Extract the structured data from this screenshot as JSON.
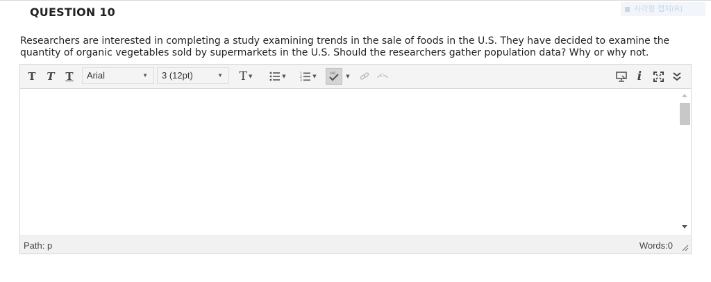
{
  "question": {
    "title": "QUESTION 10",
    "text": "Researchers are interested in completing a study examining trends in the sale of foods in the U.S. They have decided to examine the quantity of organic vegetables sold by supermarkets in the U.S. Should the researchers gather population data?  Why or why not."
  },
  "capture_badge": {
    "label": "사각형 캡처(R)"
  },
  "toolbar": {
    "bold_label": "T",
    "italic_label": "T",
    "underline_label": "T",
    "font_family": "Arial",
    "font_size": "3 (12pt)",
    "text_color_label": "T",
    "icons": [
      "format-text-icon",
      "unordered-list-icon",
      "ordered-list-icon",
      "spellcheck-icon",
      "link-icon",
      "unlink-icon",
      "preview-icon",
      "info-icon",
      "fullscreen-icon",
      "collapse-icon"
    ]
  },
  "editor": {
    "path_label": "Path: p",
    "word_count": "Words:0"
  },
  "colors": {
    "accent": "#f4f4f4",
    "border": "#d6d6d6",
    "thumb": "#c8c8c8"
  }
}
